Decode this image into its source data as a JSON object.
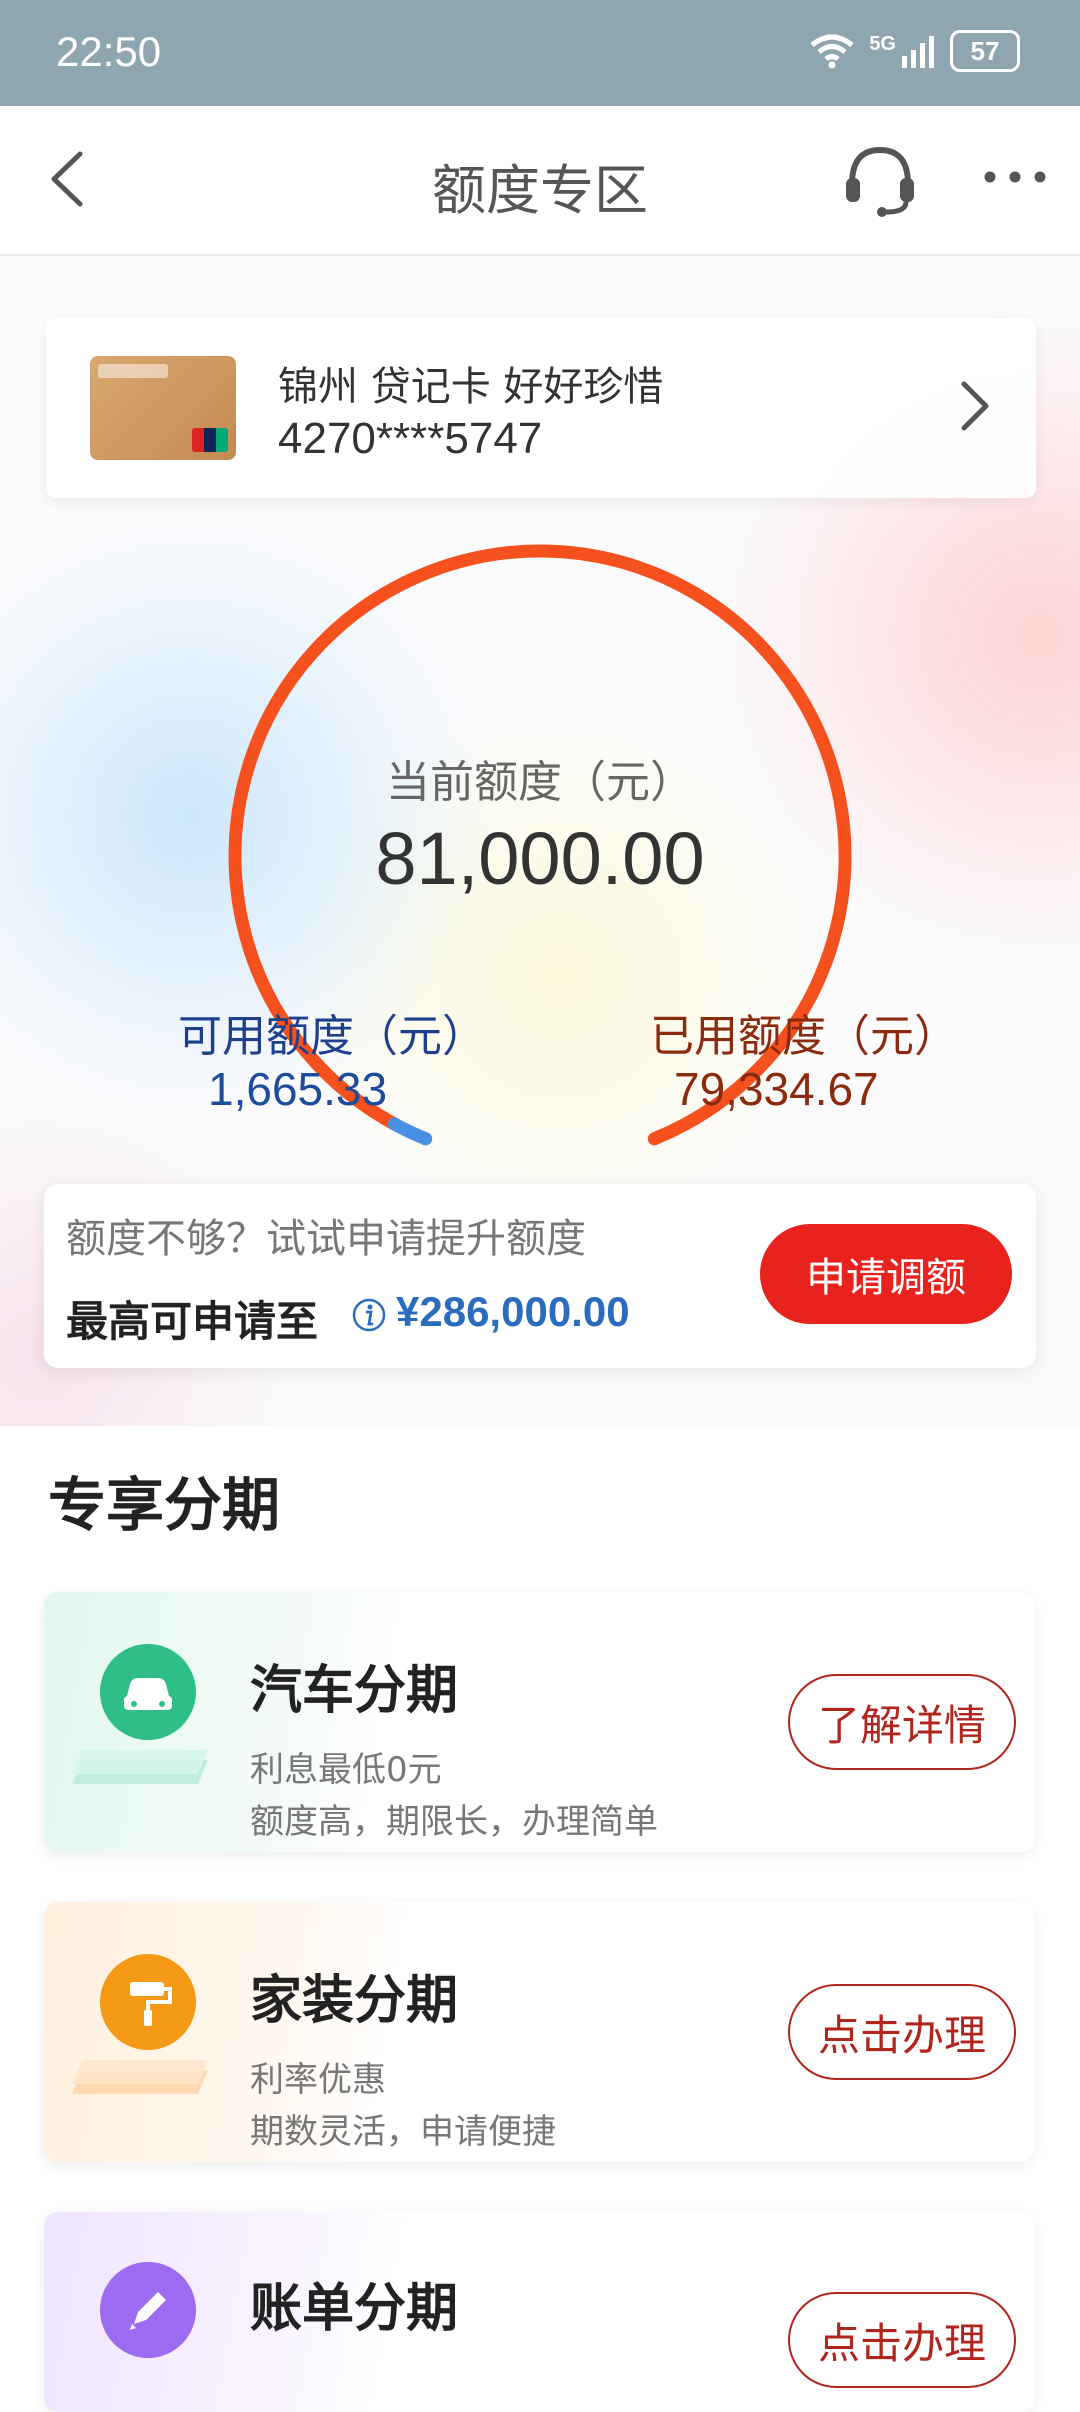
{
  "status_bar": {
    "time": "22:50",
    "network": "5G",
    "battery": "57"
  },
  "nav": {
    "title": "额度专区"
  },
  "card": {
    "name": "锦州 贷记卡 好好珍惜",
    "number": "4270****5747"
  },
  "gauge": {
    "label": "当前额度（元）",
    "total": "81,000.00",
    "available_label": "可用额度（元）",
    "available": "1,665.33",
    "used_label": "已用额度（元）",
    "used": "79,334.67",
    "available_fraction": 0.0206
  },
  "raise": {
    "hint": "额度不够？试试申请提升额度",
    "max_label": "最高可申请至",
    "max_value": "¥286,000.00",
    "button": "申请调额"
  },
  "section": {
    "title": "专享分期"
  },
  "promos": [
    {
      "title": "汽车分期",
      "sub1": "利息最低0元",
      "sub2": "额度高，期限长，办理简单",
      "button": "了解详情",
      "icon": "car-icon",
      "color": "#2fbf86"
    },
    {
      "title": "家装分期",
      "sub1": "利率优惠",
      "sub2": "期数灵活，申请便捷",
      "button": "点击办理",
      "icon": "paint-roller-icon",
      "color": "#f59a17"
    },
    {
      "title": "账单分期",
      "button": "点击办理",
      "icon": "pen-icon",
      "color": "#9b6cf0"
    }
  ],
  "colors": {
    "accent_red": "#e8231d",
    "gauge_orange": "#f4511e",
    "available_blue": "#4a90e2",
    "status_bar": "#8fa5b0"
  }
}
